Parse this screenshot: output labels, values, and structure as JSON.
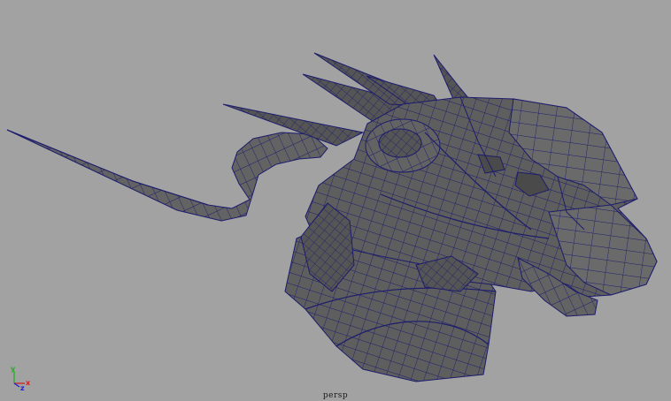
{
  "viewport": {
    "camera_name": "persp",
    "background_color": "#a2a2a2",
    "mesh_fill_color": "#5f5f5f",
    "wireframe_color": "#1c1c6c"
  },
  "axis_gizmo": {
    "x_label": "x",
    "y_label": "y",
    "z_label": "z",
    "x_color": "#d02020",
    "y_color": "#20b020",
    "z_color": "#2020d0"
  }
}
